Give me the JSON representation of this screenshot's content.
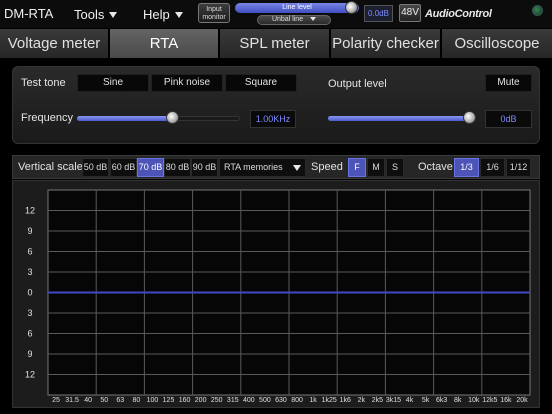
{
  "app": {
    "title": "DM-RTA"
  },
  "menu": {
    "tools": "Tools",
    "help": "Help"
  },
  "header": {
    "input_monitor_line1": "Input",
    "input_monitor_line2": "monitor",
    "line_level": "Line level",
    "unbal_line": "Unbal line",
    "level_readout": "0.0dB",
    "phantom": "48V",
    "brand": "AudioControl"
  },
  "tabs": [
    {
      "label": "Voltage meter"
    },
    {
      "label": "RTA",
      "active": true
    },
    {
      "label": "SPL meter"
    },
    {
      "label": "Polarity checker"
    },
    {
      "label": "Oscilloscope"
    }
  ],
  "tone": {
    "test_tone_label": "Test tone",
    "types": [
      "Sine",
      "Pink noise",
      "Square"
    ],
    "output_level_label": "Output level",
    "mute_label": "Mute",
    "frequency_label": "Frequency",
    "frequency_value": "1.00KHz",
    "frequency_slider_fraction": 0.59,
    "output_value": "0dB",
    "output_slider_fraction": 0.97
  },
  "controls": {
    "vertical_scale_label": "Vertical scale",
    "scales": [
      "50 dB",
      "60 dB",
      "70 dB",
      "80 dB",
      "90 dB"
    ],
    "selected_scale": "70 dB",
    "rta_memories": "RTA memories",
    "speed_label": "Speed",
    "speeds": [
      "F",
      "M",
      "S"
    ],
    "selected_speed": "F",
    "octave_label": "Octave",
    "octaves": [
      "1/3",
      "1/6",
      "1/12"
    ],
    "selected_octave": "1/3"
  },
  "colors": {
    "accent": "#4c54b8",
    "trace": "#3e48c4",
    "readout": "#7f8bff"
  },
  "chart_data": {
    "type": "line",
    "y_tick_labels": [
      "12",
      "9",
      "6",
      "3",
      "0",
      "3",
      "6",
      "9",
      "12"
    ],
    "x_tick_labels": [
      "25",
      "31.5",
      "40",
      "50",
      "63",
      "80",
      "100",
      "125",
      "160",
      "200",
      "250",
      "315",
      "400",
      "500",
      "630",
      "800",
      "1k",
      "1k25",
      "1k6",
      "2k",
      "2k5",
      "3k15",
      "4k",
      "5k",
      "6k3",
      "8k",
      "10k",
      "12k5",
      "16k",
      "20k"
    ],
    "series": [
      {
        "values": [
          0,
          0,
          0,
          0,
          0,
          0,
          0,
          0,
          0,
          0,
          0,
          0,
          0,
          0,
          0,
          0,
          0,
          0,
          0,
          0,
          0,
          0,
          0,
          0,
          0,
          0,
          0,
          0,
          0,
          0
        ]
      }
    ],
    "ylim": [
      -14,
      14
    ],
    "grid": true
  }
}
